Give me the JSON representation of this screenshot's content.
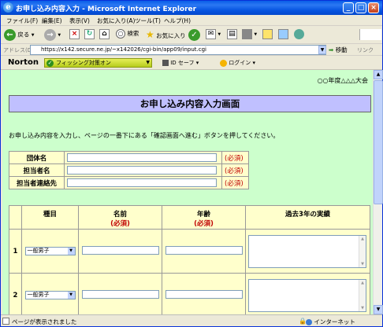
{
  "window": {
    "title": "お申し込み内容入力 - Microsoft Internet Explorer"
  },
  "menu": [
    "ファイル(F)",
    "編集(E)",
    "表示(V)",
    "お気に入り(A)",
    "ツール(T)",
    "ヘルプ(H)"
  ],
  "toolbar": {
    "back_label": "戻る",
    "search_label": "検索",
    "favorites_label": "お気に入り"
  },
  "address": {
    "label": "アドレス(D)",
    "url": "https://x142.secure.ne.jp/~x142026/cgi-bin/app09/input.cgi",
    "go_label": "移動",
    "links_label": "リンク"
  },
  "norton": {
    "logo": "Norton",
    "phishing_label": "フィッシング対策オン",
    "idsafe_label": "ID セーフ",
    "login_label": "ログイン"
  },
  "page": {
    "org": "○○年度△△△大会",
    "heading": "お申し込み内容入力画面",
    "intro": "お申し込み内容を入力し、ページの一番下にある「確認画面へ進む」ボタンを押してください。",
    "required": "(必須)",
    "info_fields": [
      {
        "label": "団体名"
      },
      {
        "label": "担当者名"
      },
      {
        "label": "担当者連絡先"
      }
    ],
    "table_headers": {
      "category": "種目",
      "name": "名前",
      "age": "年齢",
      "record": "過去3年の実績"
    },
    "rows": [
      {
        "no": "1",
        "category": "一般男子"
      },
      {
        "no": "2",
        "category": "一般男子"
      }
    ]
  },
  "status": {
    "text": "ページが表示されました",
    "zone": "インターネット"
  }
}
